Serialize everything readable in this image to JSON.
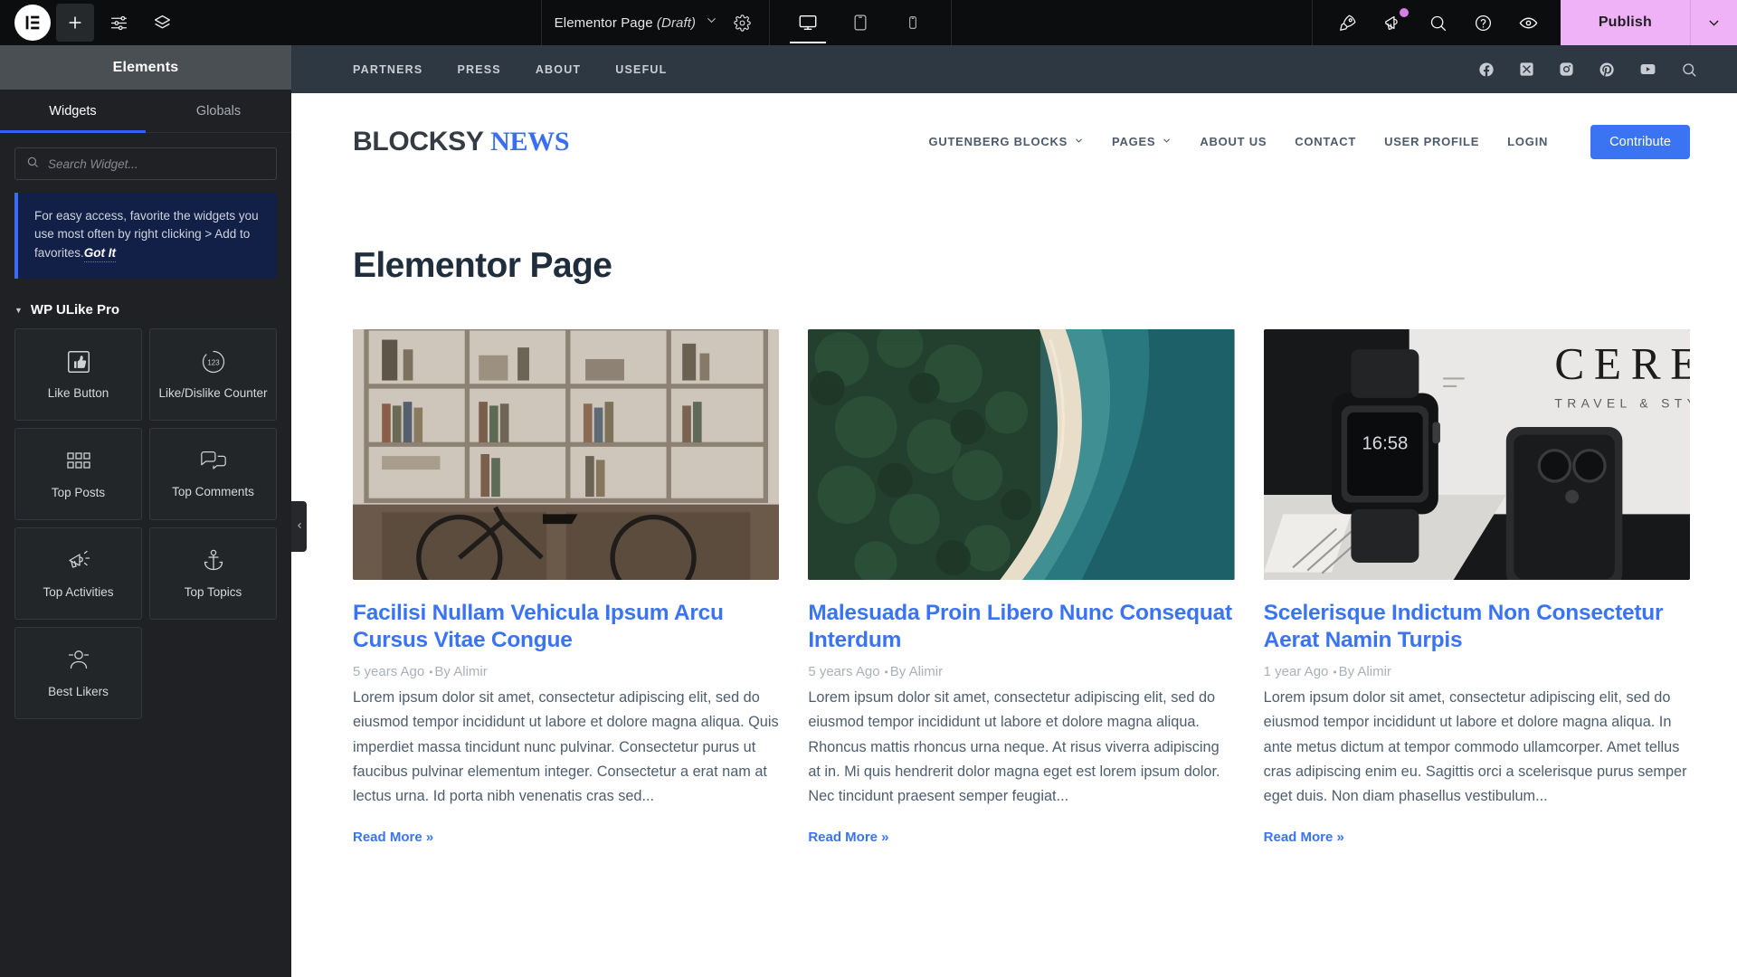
{
  "editor": {
    "logo_icon": "elementor-logo-icon",
    "toolbar_left": [
      {
        "name": "add-element-button",
        "icon": "plus-icon",
        "active": true
      },
      {
        "name": "settings-sliders-button",
        "icon": "sliders-icon",
        "active": false
      },
      {
        "name": "layers-button",
        "icon": "layers-icon",
        "active": false
      }
    ],
    "document_title": "Elementor Page",
    "document_status": "(Draft)",
    "document_settings_icon": "gear-icon",
    "devices": [
      {
        "name": "desktop",
        "icon": "desktop-icon",
        "active": true
      },
      {
        "name": "tablet",
        "icon": "tablet-icon",
        "active": false
      },
      {
        "name": "mobile",
        "icon": "mobile-icon",
        "active": false
      }
    ],
    "right_icons": [
      {
        "name": "launchpad",
        "icon": "rocket-icon",
        "badge": false
      },
      {
        "name": "notifications",
        "icon": "megaphone-icon",
        "badge": true
      },
      {
        "name": "finder",
        "icon": "search-icon",
        "badge": false
      },
      {
        "name": "help",
        "icon": "help-circle-icon",
        "badge": false
      },
      {
        "name": "preview",
        "icon": "eye-icon",
        "badge": false
      }
    ],
    "publish_label": "Publish",
    "publish_accent": "#f0b2f7",
    "accent": "#375efc"
  },
  "panel": {
    "header_title": "Elements",
    "tabs": [
      {
        "label": "Widgets",
        "active": true
      },
      {
        "label": "Globals",
        "active": false
      }
    ],
    "search": {
      "placeholder": "Search Widget...",
      "value": "",
      "icon": "search-icon"
    },
    "notice": {
      "text": "For easy access, favorite the widgets you use most often by right clicking > Add to favorites.",
      "action": "Got It"
    },
    "category": {
      "label": "WP ULike Pro",
      "expanded": true,
      "caret": "caret-down-icon"
    },
    "widgets": [
      {
        "label": "Like Button",
        "icon": "thumbs-up-icon"
      },
      {
        "label": "Like/Dislike Counter",
        "icon": "counter-123-icon"
      },
      {
        "label": "Top Posts",
        "icon": "grid-icon"
      },
      {
        "label": "Top Comments",
        "icon": "comments-icon"
      },
      {
        "label": "Top Activities",
        "icon": "megaphone-icon"
      },
      {
        "label": "Top Topics",
        "icon": "anchor-icon"
      },
      {
        "label": "Best Likers",
        "icon": "user-badge-icon"
      }
    ],
    "collapse_icon": "chevron-left-icon"
  },
  "site": {
    "topbar": {
      "links": [
        "PARTNERS",
        "PRESS",
        "ABOUT",
        "USEFUL"
      ],
      "social": [
        "facebook-icon",
        "x-twitter-icon",
        "instagram-icon",
        "pinterest-icon",
        "youtube-icon",
        "search-icon"
      ],
      "bg": "#2d3843"
    },
    "brand": {
      "part1": "BLOCKSY",
      "part2": "NEWS"
    },
    "nav": [
      {
        "label": "GUTENBERG BLOCKS",
        "caret": true
      },
      {
        "label": "PAGES",
        "caret": true
      },
      {
        "label": "ABOUT US",
        "caret": false
      },
      {
        "label": "CONTACT",
        "caret": false
      },
      {
        "label": "USER PROFILE",
        "caret": false
      },
      {
        "label": "LOGIN",
        "caret": false
      }
    ],
    "cta": {
      "label": "Contribute",
      "color": "#3b74f2"
    },
    "page_title": "Elementor Page",
    "posts": [
      {
        "image": "bookshelf-bicycle-photo",
        "title": "Facilisi Nullam Vehicula Ipsum Arcu Cursus Vitae Congue",
        "date": "5 years Ago",
        "author": "By Alimir",
        "excerpt": "Lorem ipsum dolor sit amet, consectetur adipiscing elit, sed do eiusmod tempor incididunt ut labore et dolore magna aliqua. Quis imperdiet massa tincidunt nunc pulvinar. Consectetur purus ut faucibus pulvinar elementum integer. Consectetur a erat nam at lectus urna. Id porta nibh venenatis cras sed...",
        "read_more": "Read More »"
      },
      {
        "image": "aerial-coastline-forest-photo",
        "title": "Malesuada Proin Libero Nunc Consequat Interdum",
        "date": "5 years Ago",
        "author": "By Alimir",
        "excerpt": "Lorem ipsum dolor sit amet, consectetur adipiscing elit, sed do eiusmod tempor incididunt ut labore et dolore magna aliqua. Rhoncus mattis rhoncus urna neque. At risus viverra adipiscing at in. Mi quis hendrerit dolor magna eget est lorem ipsum dolor. Nec tincidunt praesent semper feugiat...",
        "read_more": "Read More »"
      },
      {
        "image": "smartwatch-magazine-phone-photo",
        "title": "Scelerisque Indictum Non Consectetur Aerat Namin Turpis",
        "date": "1 year Ago",
        "author": "By Alimir",
        "excerpt": "Lorem ipsum dolor sit amet, consectetur adipiscing elit, sed do eiusmod tempor incididunt ut labore et dolore magna aliqua. In ante metus dictum at tempor commodo ullamcorper. Amet tellus cras adipiscing enim eu. Sagittis orci a scelerisque purus semper eget duis. Non diam phasellus vestibulum...",
        "read_more": "Read More »"
      }
    ]
  }
}
